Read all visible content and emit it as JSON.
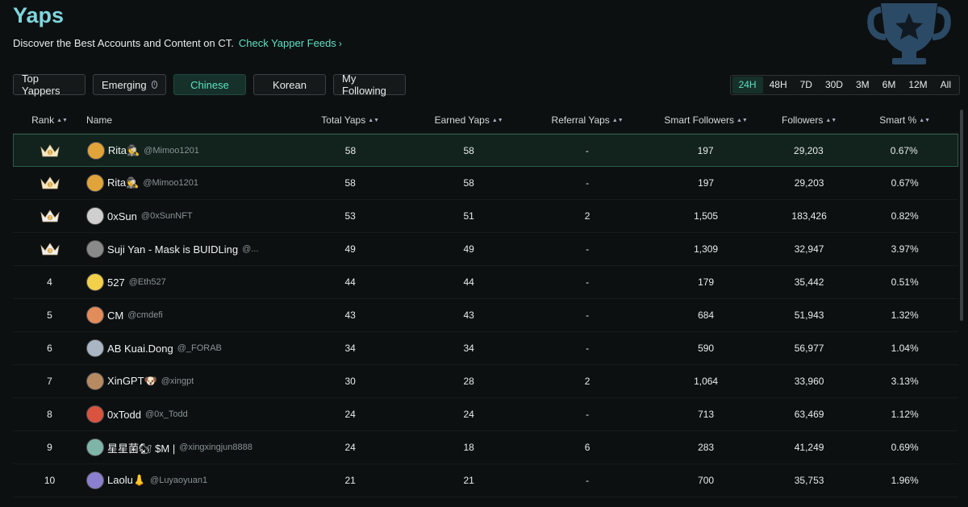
{
  "header": {
    "title": "Yaps",
    "subtitle": "Discover the Best Accounts and Content on CT.",
    "link_label": "Check Yapper Feeds",
    "trophy_icon": "trophy-icon"
  },
  "filters": [
    {
      "label": "Top Yappers",
      "active": false
    },
    {
      "label": "Emerging",
      "active": false,
      "icon": "info-icon"
    },
    {
      "label": "Chinese",
      "active": true
    },
    {
      "label": "Korean",
      "active": false
    },
    {
      "label": "My Following",
      "active": false
    }
  ],
  "periods": [
    "24H",
    "48H",
    "7D",
    "30D",
    "3M",
    "6M",
    "12M",
    "All"
  ],
  "active_period": "24H",
  "columns": {
    "rank": "Rank",
    "name": "Name",
    "total": "Total Yaps",
    "earned": "Earned Yaps",
    "referral": "Referral Yaps",
    "smart_followers": "Smart Followers",
    "followers": "Followers",
    "smart_pct": "Smart %"
  },
  "rows": [
    {
      "rank": "1",
      "crown": true,
      "name": "Rita🕵",
      "handle": "@Mimoo1201",
      "total": "58",
      "earned": "58",
      "referral": "-",
      "smart_followers": "197",
      "followers": "29,203",
      "smart_pct": "0.67%",
      "avatar_color": "#e0a43a",
      "highlight": true
    },
    {
      "rank": "1",
      "crown": true,
      "name": "Rita🕵",
      "handle": "@Mimoo1201",
      "total": "58",
      "earned": "58",
      "referral": "-",
      "smart_followers": "197",
      "followers": "29,203",
      "smart_pct": "0.67%",
      "avatar_color": "#e0a43a",
      "highlight": false
    },
    {
      "rank": "2",
      "crown": true,
      "name": "0xSun",
      "handle": "@0xSunNFT",
      "total": "53",
      "earned": "51",
      "referral": "2",
      "smart_followers": "1,505",
      "followers": "183,426",
      "smart_pct": "0.82%",
      "avatar_color": "#cfcfcf",
      "highlight": false
    },
    {
      "rank": "3",
      "crown": true,
      "name": "Suji Yan - Mask is BUIDLing",
      "handle": "@...",
      "total": "49",
      "earned": "49",
      "referral": "-",
      "smart_followers": "1,309",
      "followers": "32,947",
      "smart_pct": "3.97%",
      "avatar_color": "#8a8a8a",
      "highlight": false
    },
    {
      "rank": "4",
      "crown": false,
      "name": "527",
      "handle": "@Eth527",
      "total": "44",
      "earned": "44",
      "referral": "-",
      "smart_followers": "179",
      "followers": "35,442",
      "smart_pct": "0.51%",
      "avatar_color": "#f2d04a",
      "highlight": false
    },
    {
      "rank": "5",
      "crown": false,
      "name": "CM",
      "handle": "@cmdefi",
      "total": "43",
      "earned": "43",
      "referral": "-",
      "smart_followers": "684",
      "followers": "51,943",
      "smart_pct": "1.32%",
      "avatar_color": "#e28b5b",
      "highlight": false
    },
    {
      "rank": "6",
      "crown": false,
      "name": "AB Kuai.Dong",
      "handle": "@_FORAB",
      "total": "34",
      "earned": "34",
      "referral": "-",
      "smart_followers": "590",
      "followers": "56,977",
      "smart_pct": "1.04%",
      "avatar_color": "#a9b7c4",
      "highlight": false
    },
    {
      "rank": "7",
      "crown": false,
      "name": "XinGPT🐶",
      "handle": "@xingpt",
      "total": "30",
      "earned": "28",
      "referral": "2",
      "smart_followers": "1,064",
      "followers": "33,960",
      "smart_pct": "3.13%",
      "avatar_color": "#b88a62",
      "highlight": false
    },
    {
      "rank": "8",
      "crown": false,
      "name": "0xTodd",
      "handle": "@0x_Todd",
      "total": "24",
      "earned": "24",
      "referral": "-",
      "smart_followers": "713",
      "followers": "63,469",
      "smart_pct": "1.12%",
      "avatar_color": "#d9533f",
      "highlight": false
    },
    {
      "rank": "9",
      "crown": false,
      "name": "星星菌🐿 $M | ",
      "handle": "@xingxingjun8888",
      "total": "24",
      "earned": "18",
      "referral": "6",
      "smart_followers": "283",
      "followers": "41,249",
      "smart_pct": "0.69%",
      "avatar_color": "#7fb5a8",
      "highlight": false
    },
    {
      "rank": "10",
      "crown": false,
      "name": "Laolu👃",
      "handle": "@Luyaoyuan1",
      "total": "21",
      "earned": "21",
      "referral": "-",
      "smart_followers": "700",
      "followers": "35,753",
      "smart_pct": "1.96%",
      "avatar_color": "#8b7fcf",
      "highlight": false
    }
  ],
  "colors": {
    "accent": "#5fe0c2",
    "title": "#7fd6dc",
    "background": "#0d1011"
  }
}
